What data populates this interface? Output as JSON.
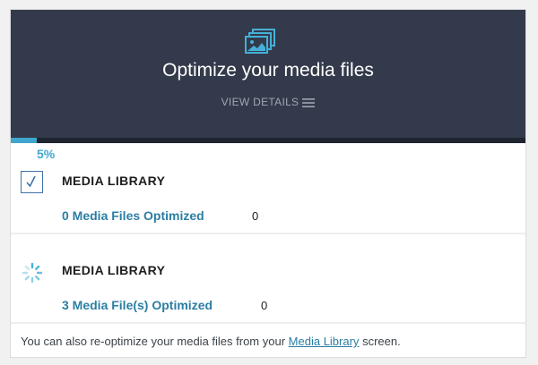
{
  "header": {
    "icon": "images-stack-icon",
    "title": "Optimize your media files",
    "view_details_label": "VIEW DETAILS",
    "view_details_icon": "hamburger-menu-icon"
  },
  "progress": {
    "percent": 5,
    "label": "5%",
    "fill_color": "#3fa6cc"
  },
  "sections": [
    {
      "status_icon": "checkbox-checked-icon",
      "title": "MEDIA LIBRARY",
      "link_label": "0 Media Files Optimized",
      "count": "0"
    },
    {
      "status_icon": "loading-spinner-icon",
      "title": "MEDIA LIBRARY",
      "link_label": "3 Media File(s) Optimized",
      "count": "0"
    }
  ],
  "footer": {
    "text_before": "You can also re-optimize your media files from your",
    "link_label": "Media Library",
    "text_after": "screen."
  },
  "colors": {
    "header_bg": "#333a4b",
    "accent": "#40a8cf",
    "link": "#2a7ea3"
  }
}
